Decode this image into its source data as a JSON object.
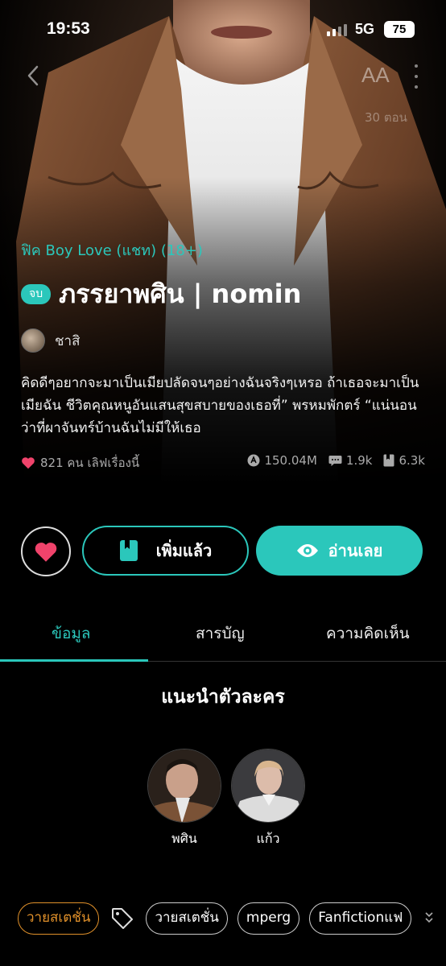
{
  "status_bar": {
    "time": "19:53",
    "network": "5G",
    "battery": "75"
  },
  "nav": {
    "font_label": "AA",
    "episode_count": "30 ตอน"
  },
  "story": {
    "genre": "ฟิค Boy Love (แชท) (18+)",
    "status_badge": "จบ",
    "title": "ภรรยาพศิน | nomin",
    "author": "ชาสิ",
    "synopsis": "คิดดีๆอยากจะมาเป็นเมียปลัดจนๆอย่างฉันจริงๆเหรอ ถ้าเธอจะมาเป็นเมียฉัน ชีวิตคุณหนูอันแสนสุขสบายของเธอที่” พรหมพักตร์ “แน่นอนว่าที่ผาจันทร์บ้านฉันไม่มีให้เธอ"
  },
  "stats": {
    "likes": "821 คน เลิฟเรื่องนี้",
    "views": "150.04M",
    "comments": "1.9k",
    "bookmarks": "6.3k"
  },
  "actions": {
    "added_label": "เพิ่มแล้ว",
    "read_label": "อ่านเลย"
  },
  "tabs": [
    {
      "label": "ข้อมูล"
    },
    {
      "label": "สารบัญ"
    },
    {
      "label": "ความคิดเห็น"
    }
  ],
  "characters": {
    "title": "แนะนำตัวละคร",
    "items": [
      {
        "name": "พศิน"
      },
      {
        "name": "แก้ว"
      }
    ]
  },
  "tags": [
    {
      "label": "วายสเตชั่น"
    },
    {
      "label": "วายสเตชั่น"
    },
    {
      "label": "mperg"
    },
    {
      "label": "Fanfictionแฟ"
    }
  ],
  "colors": {
    "accent": "#2bc7bb",
    "like": "#f0436b",
    "tag_highlight": "#e0902a"
  },
  "icons": [
    "back-icon",
    "font-size-icon",
    "more-icon",
    "heart-icon",
    "view-icon",
    "comment-icon",
    "bookmark-icon",
    "book-icon",
    "eye-icon",
    "tag-icon",
    "chevron-down-icon"
  ]
}
